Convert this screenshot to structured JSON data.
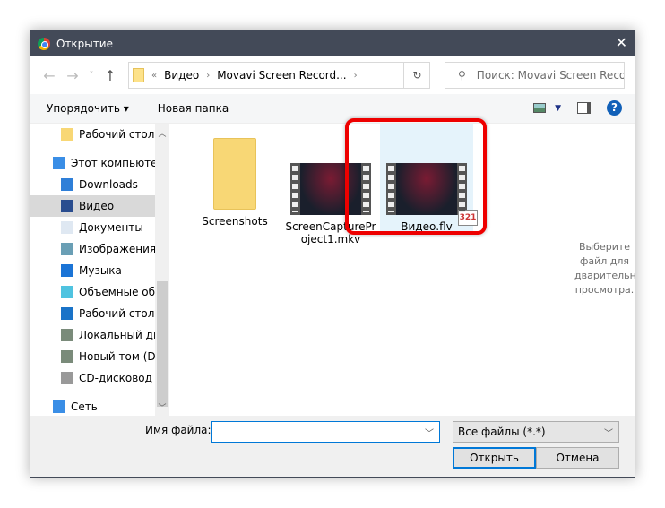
{
  "window": {
    "title": "Открытие",
    "close": "✕"
  },
  "nav": {
    "back": "←",
    "forward": "→",
    "recent": "˅",
    "up": "↑",
    "path_prefix": "«",
    "path": [
      "Видео",
      "Movavi Screen Record..."
    ],
    "refresh": "↻",
    "search_placeholder": "Поиск: Movavi Screen Recor..."
  },
  "toolbar": {
    "organize": "Упорядочить ▾",
    "new_folder": "Новая папка"
  },
  "sidebar": {
    "items": [
      {
        "label": "Рабочий стол",
        "icon": "folder-icon",
        "indent": true
      },
      {
        "label": "Этот компьютер",
        "icon": "computer-icon",
        "indent": false
      },
      {
        "label": "Downloads",
        "icon": "download-icon",
        "indent": true
      },
      {
        "label": "Видео",
        "icon": "video-icon",
        "indent": true,
        "selected": true
      },
      {
        "label": "Документы",
        "icon": "document-icon",
        "indent": true
      },
      {
        "label": "Изображения",
        "icon": "pictures-icon",
        "indent": true
      },
      {
        "label": "Музыка",
        "icon": "music-icon",
        "indent": true
      },
      {
        "label": "Объемные объ",
        "icon": "3d-objects-icon",
        "indent": true
      },
      {
        "label": "Рабочий стол",
        "icon": "desktop-icon",
        "indent": true
      },
      {
        "label": "Локальный дис",
        "icon": "local-disk-icon",
        "indent": true
      },
      {
        "label": "Новый том (D:)",
        "icon": "drive-icon",
        "indent": true
      },
      {
        "label": "CD-дисковод (F:",
        "icon": "cd-drive-icon",
        "indent": true
      },
      {
        "label": "Сеть",
        "icon": "network-icon",
        "indent": false
      }
    ]
  },
  "files": [
    {
      "name": "Screenshots",
      "type": "folder"
    },
    {
      "name": "ScreenCapturePr oject1.mkv",
      "type": "video"
    },
    {
      "name": "Видео.flv",
      "type": "video",
      "selected": true,
      "badge": "321"
    }
  ],
  "preview": {
    "text": [
      "Выберите",
      "файл для",
      "дварительн",
      "просмотра."
    ]
  },
  "bottom": {
    "filename_label": "Имя файла:",
    "filename_value": "",
    "filetype": "Все файлы (*.*)",
    "open": "Открыть",
    "cancel": "Отмена"
  },
  "colors": {
    "titlebar": "#434a58",
    "highlight": "#e00000",
    "accent": "#0078d7"
  }
}
